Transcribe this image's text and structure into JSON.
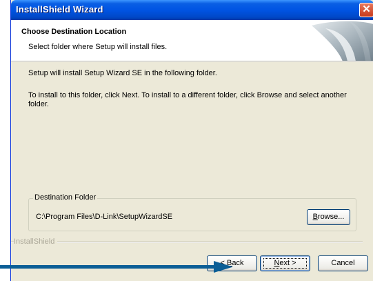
{
  "window": {
    "title": "InstallShield Wizard",
    "close_symbol": "✕"
  },
  "header": {
    "title": "Choose Destination Location",
    "subtitle": "Select folder where Setup will install files."
  },
  "body": {
    "line1": "Setup will install Setup Wizard SE in the following folder.",
    "line2": "To install to this folder, click Next. To install to a different folder, click Browse and select another folder."
  },
  "destination": {
    "legend": "Destination Folder",
    "path": "C:\\Program Files\\D-Link\\SetupWizardSE"
  },
  "buttons": {
    "browse": {
      "accel": "B",
      "rest": "rowse..."
    },
    "back": {
      "pre": "< ",
      "accel": "B",
      "rest": "ack"
    },
    "next": {
      "accel": "N",
      "rest": "ext >"
    },
    "cancel": "Cancel"
  },
  "branding": "InstallShield",
  "colors": {
    "titlebar": "#0054e3",
    "face": "#ece9d8",
    "arrow": "#0b5e96"
  }
}
